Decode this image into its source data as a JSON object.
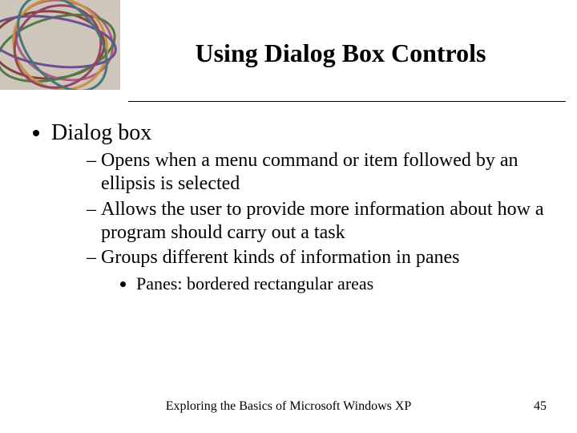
{
  "slide": {
    "title": "Using Dialog Box Controls",
    "bullets": {
      "l1": "Dialog box",
      "l2": [
        "Opens when a menu command or item followed by an ellipsis is selected",
        "Allows the user to provide more information about how a program should carry out a task",
        "Groups different kinds of information in panes"
      ],
      "l3": "Panes: bordered rectangular areas"
    },
    "footer_center": "Exploring the Basics of Microsoft Windows XP",
    "footer_page": "45"
  }
}
